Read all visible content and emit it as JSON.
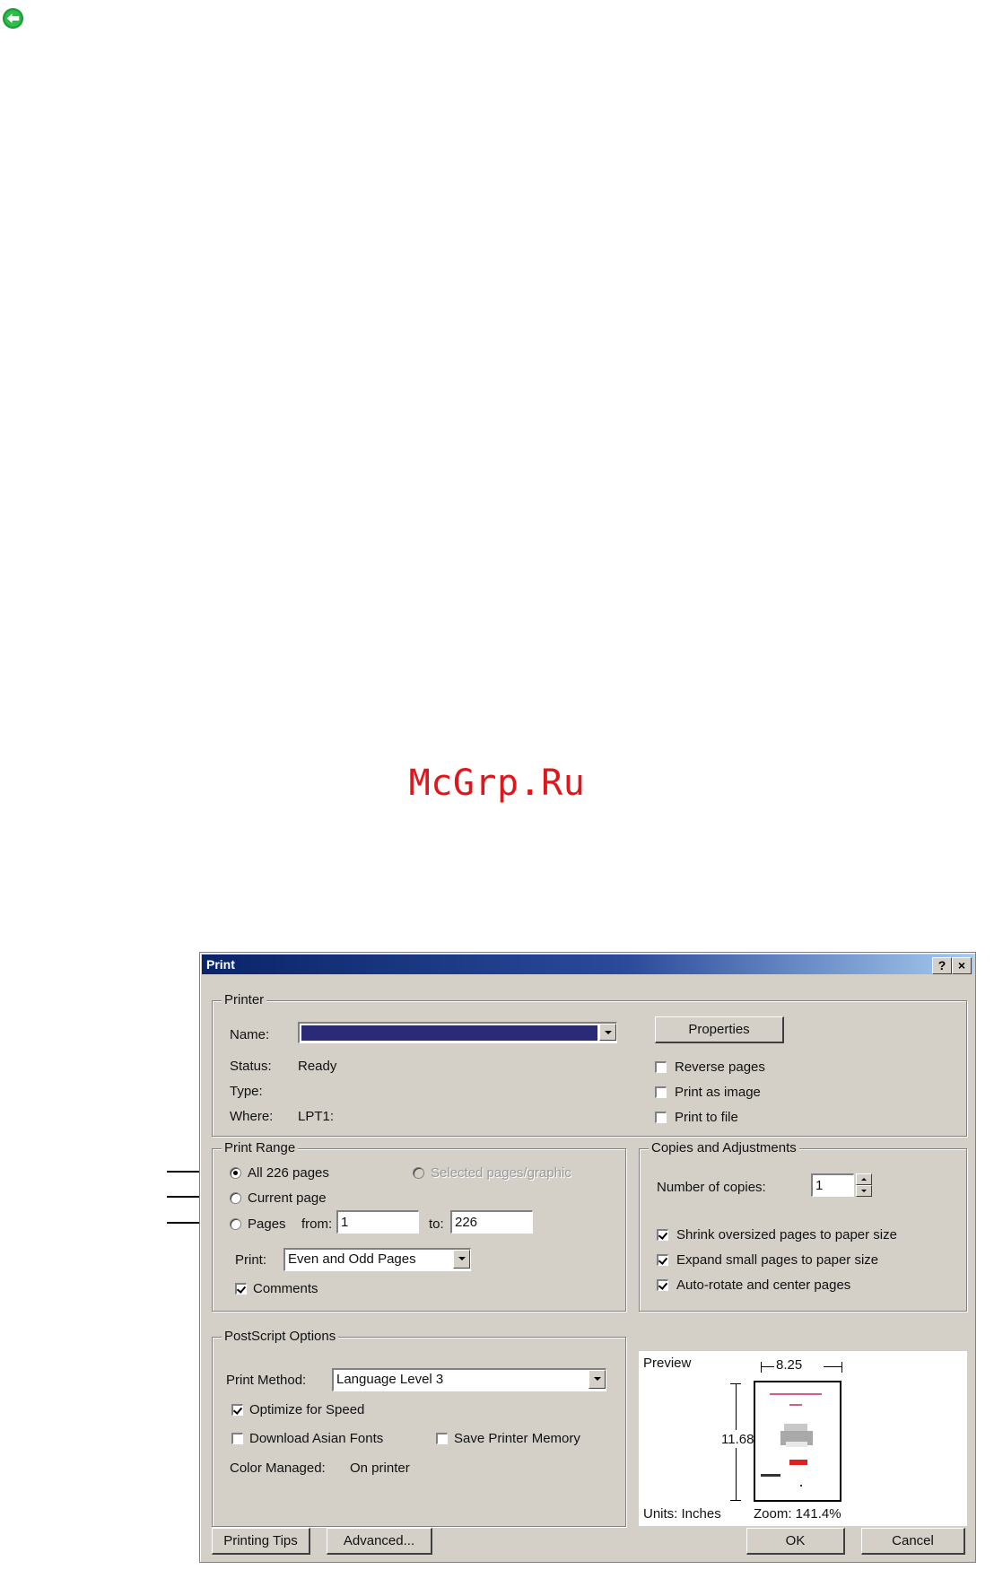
{
  "watermark": "McGrp.Ru",
  "dialog": {
    "title": "Print",
    "help_btn": "?",
    "close_btn": "×",
    "printer": {
      "group_title": "Printer",
      "name_label": "Name:",
      "name_value": "",
      "properties_btn": "Properties",
      "status_label": "Status:",
      "status_value": "Ready",
      "type_label": "Type:",
      "type_value": "",
      "where_label": "Where:",
      "where_value": "LPT1:",
      "reverse_pages": {
        "label": "Reverse pages",
        "checked": false
      },
      "print_as_image": {
        "label": "Print as image",
        "checked": false
      },
      "print_to_file": {
        "label": "Print to file",
        "checked": false
      }
    },
    "print_range": {
      "group_title": "Print Range",
      "all_pages": "All 226 pages",
      "selected": "Selected pages/graphic",
      "current_page": "Current page",
      "pages": "Pages",
      "from_label": "from:",
      "from_value": "1",
      "to_label": "to:",
      "to_value": "226",
      "print_label": "Print:",
      "print_value": "Even and Odd Pages",
      "comments": {
        "label": "Comments",
        "checked": true
      },
      "selected_option": "all"
    },
    "copies": {
      "group_title": "Copies and Adjustments",
      "number_label": "Number of copies:",
      "number_value": "1",
      "shrink": {
        "label": "Shrink oversized pages to paper size",
        "checked": true
      },
      "expand": {
        "label": "Expand small pages to paper size",
        "checked": true
      },
      "autorotate": {
        "label": "Auto-rotate and center pages",
        "checked": true
      }
    },
    "postscript": {
      "group_title": "PostScript Options",
      "method_label": "Print Method:",
      "method_value": "Language Level 3",
      "optimize": {
        "label": "Optimize for Speed",
        "checked": true
      },
      "download_fonts": {
        "label": "Download Asian Fonts",
        "checked": false
      },
      "save_memory": {
        "label": "Save Printer Memory",
        "checked": false
      },
      "color_label": "Color Managed:",
      "color_value": "On printer"
    },
    "preview": {
      "label": "Preview",
      "width": "8.25",
      "height": "11.68",
      "units": "Units: Inches",
      "zoom": "Zoom: 141.4%"
    },
    "buttons": {
      "printing_tips": "Printing Tips",
      "advanced": "Advanced...",
      "ok": "OK",
      "cancel": "Cancel"
    }
  }
}
